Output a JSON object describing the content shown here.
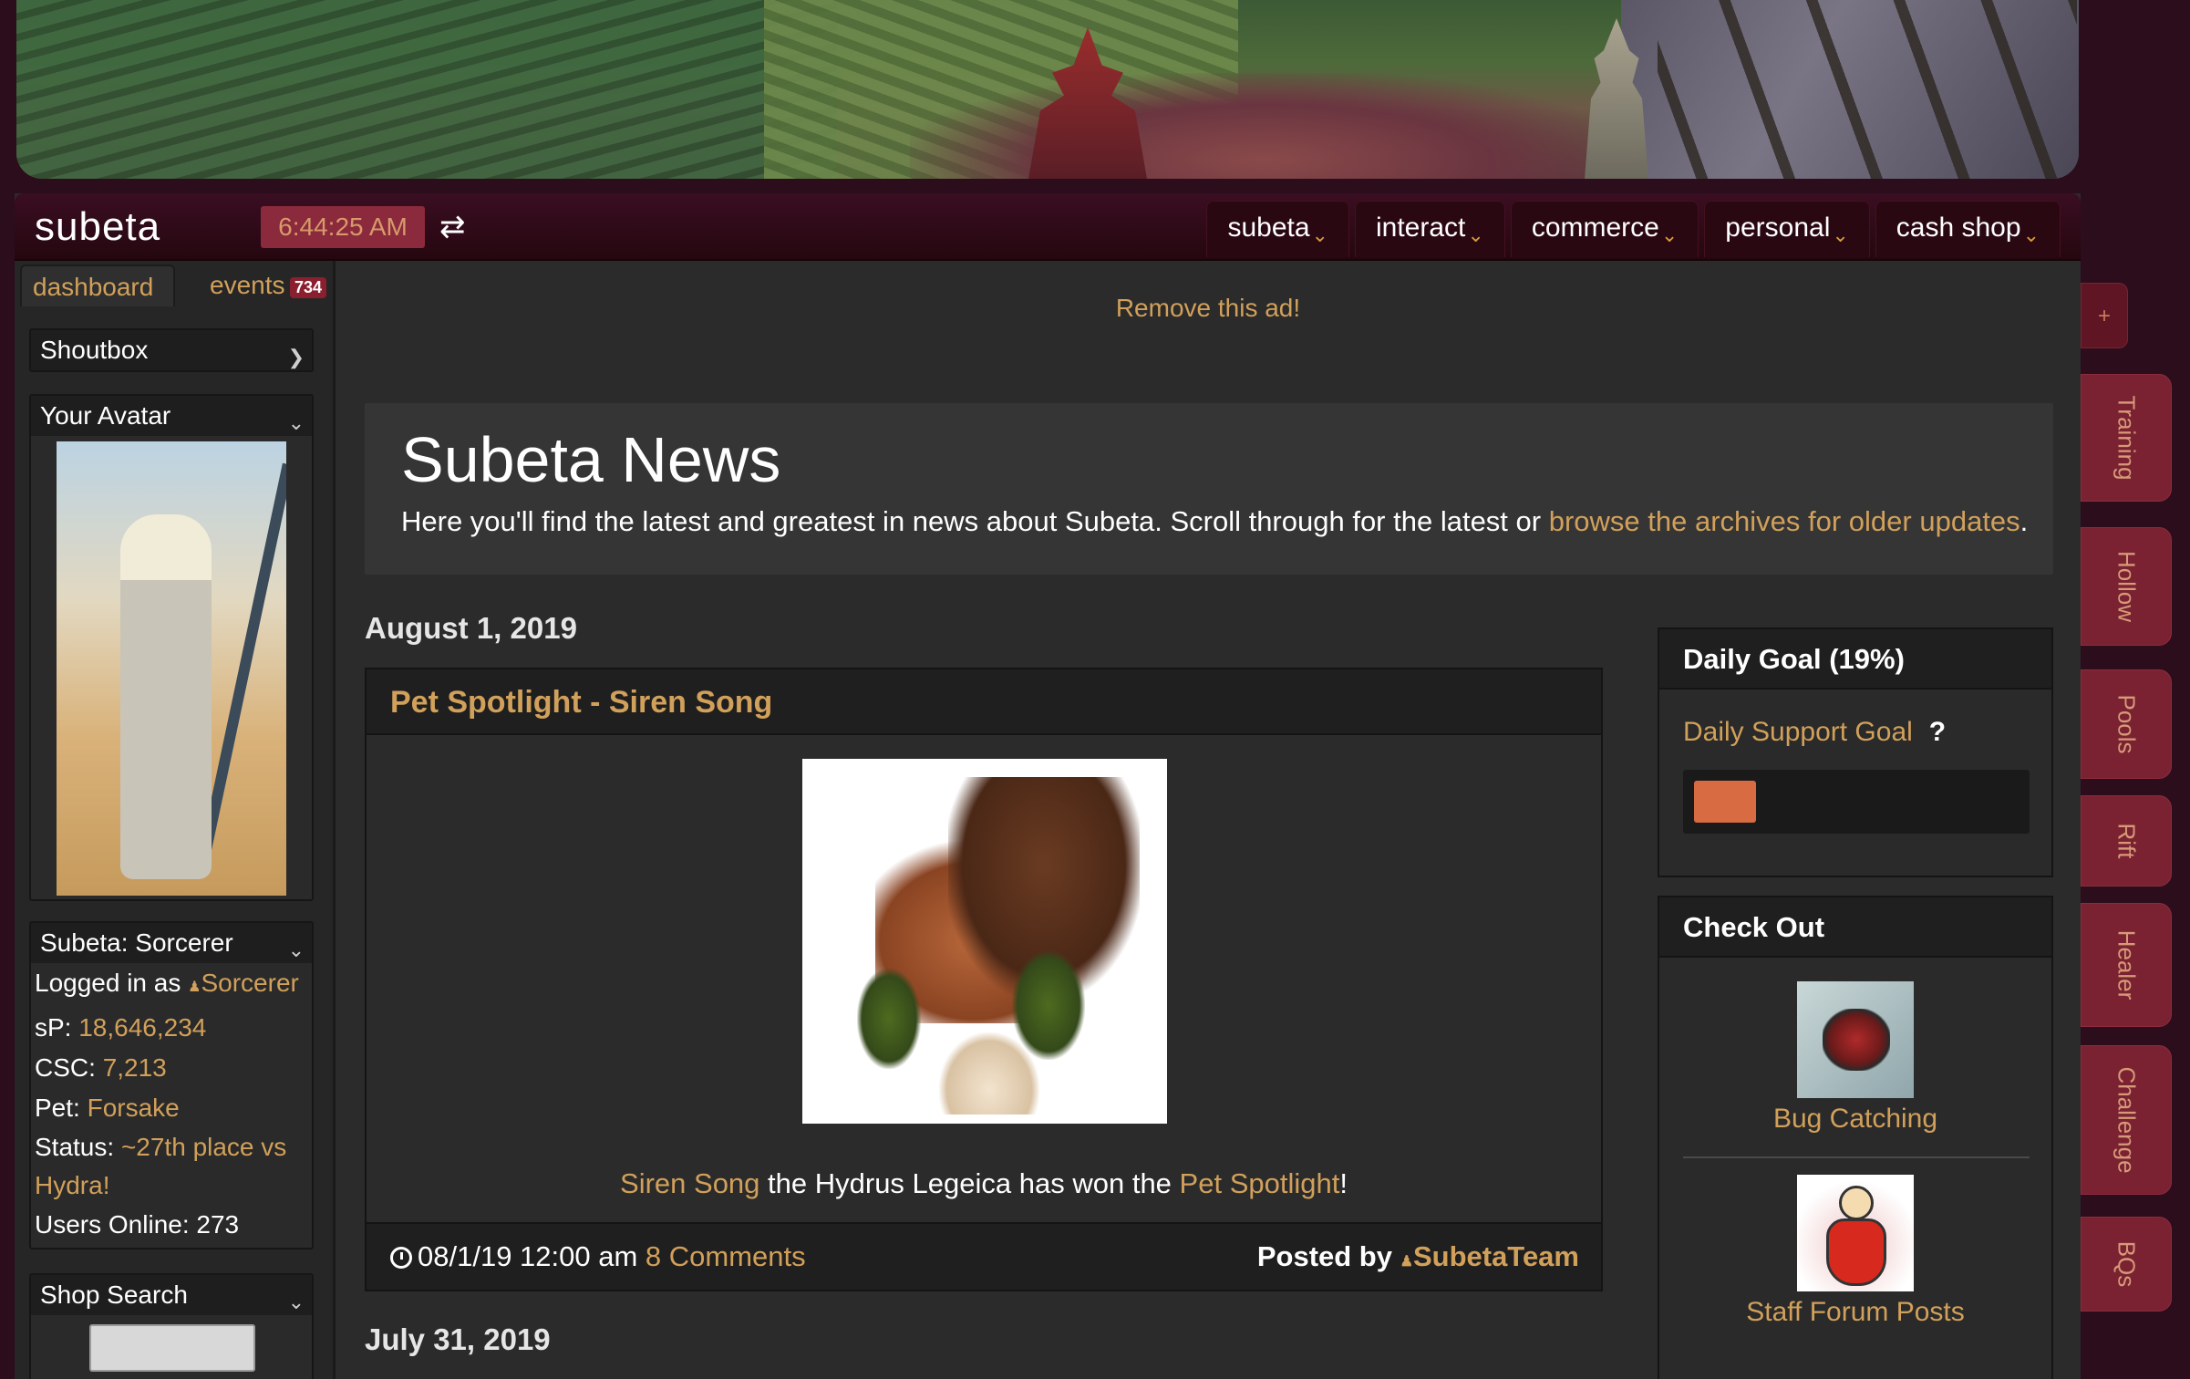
{
  "header": {
    "logo": "subeta",
    "time": "6:44:25 AM",
    "nav": [
      "subeta",
      "interact",
      "commerce",
      "personal",
      "cash shop"
    ]
  },
  "sidebar": {
    "tabs": {
      "dashboard": "dashboard",
      "events": "events",
      "events_count": "734"
    },
    "shoutbox": "Shoutbox",
    "avatar_title": "Your Avatar",
    "user_box": {
      "title": "Subeta: Sorcerer",
      "logged_in_label": "Logged in as ",
      "username": "Sorcerer",
      "sp_label": "sP: ",
      "sp_value": "18,646,234",
      "csc_label": "CSC: ",
      "csc_value": "7,213",
      "pet_label": "Pet: ",
      "pet_value": "Forsake",
      "status_label": "Status: ",
      "status_value": "~27th place vs Hydra!",
      "users_online": "Users Online: 273"
    },
    "shop_search_title": "Shop Search"
  },
  "main": {
    "remove_ad": "Remove this ad!",
    "news_title": "Subeta News",
    "news_desc": "Here you'll find the latest and greatest in news about Subeta. Scroll through for the latest or ",
    "news_link": "browse the archives for older updates",
    "news_desc_end": ".",
    "date1": "August 1, 2019",
    "post": {
      "title": "Pet Spotlight - Siren Song",
      "caption_link1": "Siren Song",
      "caption_mid": " the Hydrus Legeica has won the ",
      "caption_link2": "Pet Spotlight",
      "caption_end": "!",
      "datetime": "08/1/19 12:00 am",
      "comments": "8 Comments",
      "posted_by_label": "Posted by ",
      "author": "SubetaTeam"
    },
    "date2": "July 31, 2019"
  },
  "widgets": {
    "daily_goal_title": "Daily Goal (19%)",
    "daily_support_label": "Daily Support Goal",
    "help_icon": "?",
    "progress_fraction": 0.19,
    "progress_color": "#d86b42",
    "check_out_title": "Check Out",
    "check_out_items": [
      "Bug Catching",
      "Staff Forum Posts"
    ]
  },
  "side_tabs": {
    "plus": "+",
    "tabs": [
      "Training",
      "Hollow",
      "Pools",
      "Rift",
      "Healer",
      "Challenge",
      "BQs"
    ]
  },
  "colors": {
    "accent_gold": "#d1a05a",
    "header_maroon": "#3a0e22",
    "page_background": "#2b0d1c",
    "side_tab": "#7a2232"
  }
}
